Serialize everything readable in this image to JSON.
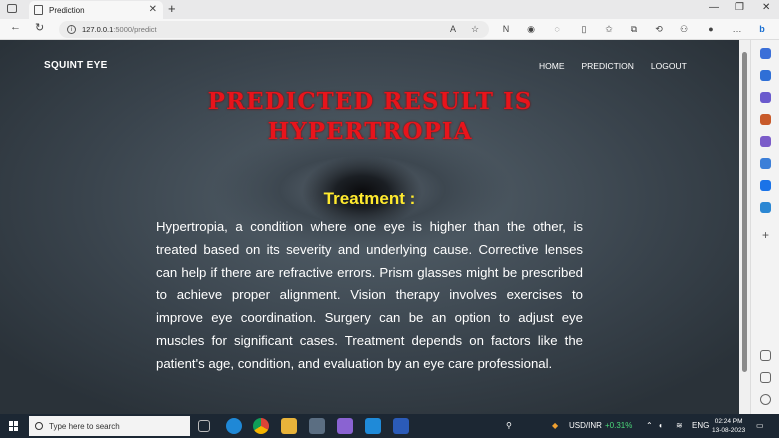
{
  "browser": {
    "tab_title": "Prediction",
    "url_host": "127.0.0.1",
    "url_path": ":5000/predict"
  },
  "site": {
    "brand": "SQUINT EYE",
    "nav": [
      "HOME",
      "PREDICTION",
      "LOGOUT"
    ]
  },
  "result": {
    "title_line1": "PREDICTED RESULT IS",
    "title_line2": "HYPERTROPIA",
    "treatment_heading": "Treatment :",
    "treatment_text": "Hypertropia, a condition where one eye is higher than the other, is treated based on its severity and underlying cause. Corrective lenses can help if there are refractive errors. Prism glasses might be prescribed to achieve proper alignment. Vision therapy involves exercises to improve eye coordination. Surgery can be an option to adjust eye muscles for significant cases. Treatment depends on factors like the patient's age, condition, and evaluation by an eye care professional."
  },
  "taskbar": {
    "search_placeholder": "Type here to search",
    "ticker": "USD/INR",
    "ticker_change": "+0.31%",
    "lang": "ENG",
    "time": "02:24 PM",
    "date": "13-08-2023"
  },
  "colors": {
    "title_red": "#e8141b",
    "heading_yellow": "#ffea2e",
    "ticker_green": "#4cd97b"
  },
  "icons": {
    "app_icons": [
      "file-explorer-icon",
      "edge-icon",
      "chrome-icon",
      "folder-icon",
      "terminal-icon",
      "visual-studio-icon",
      "vscode-icon",
      "word-icon"
    ]
  }
}
